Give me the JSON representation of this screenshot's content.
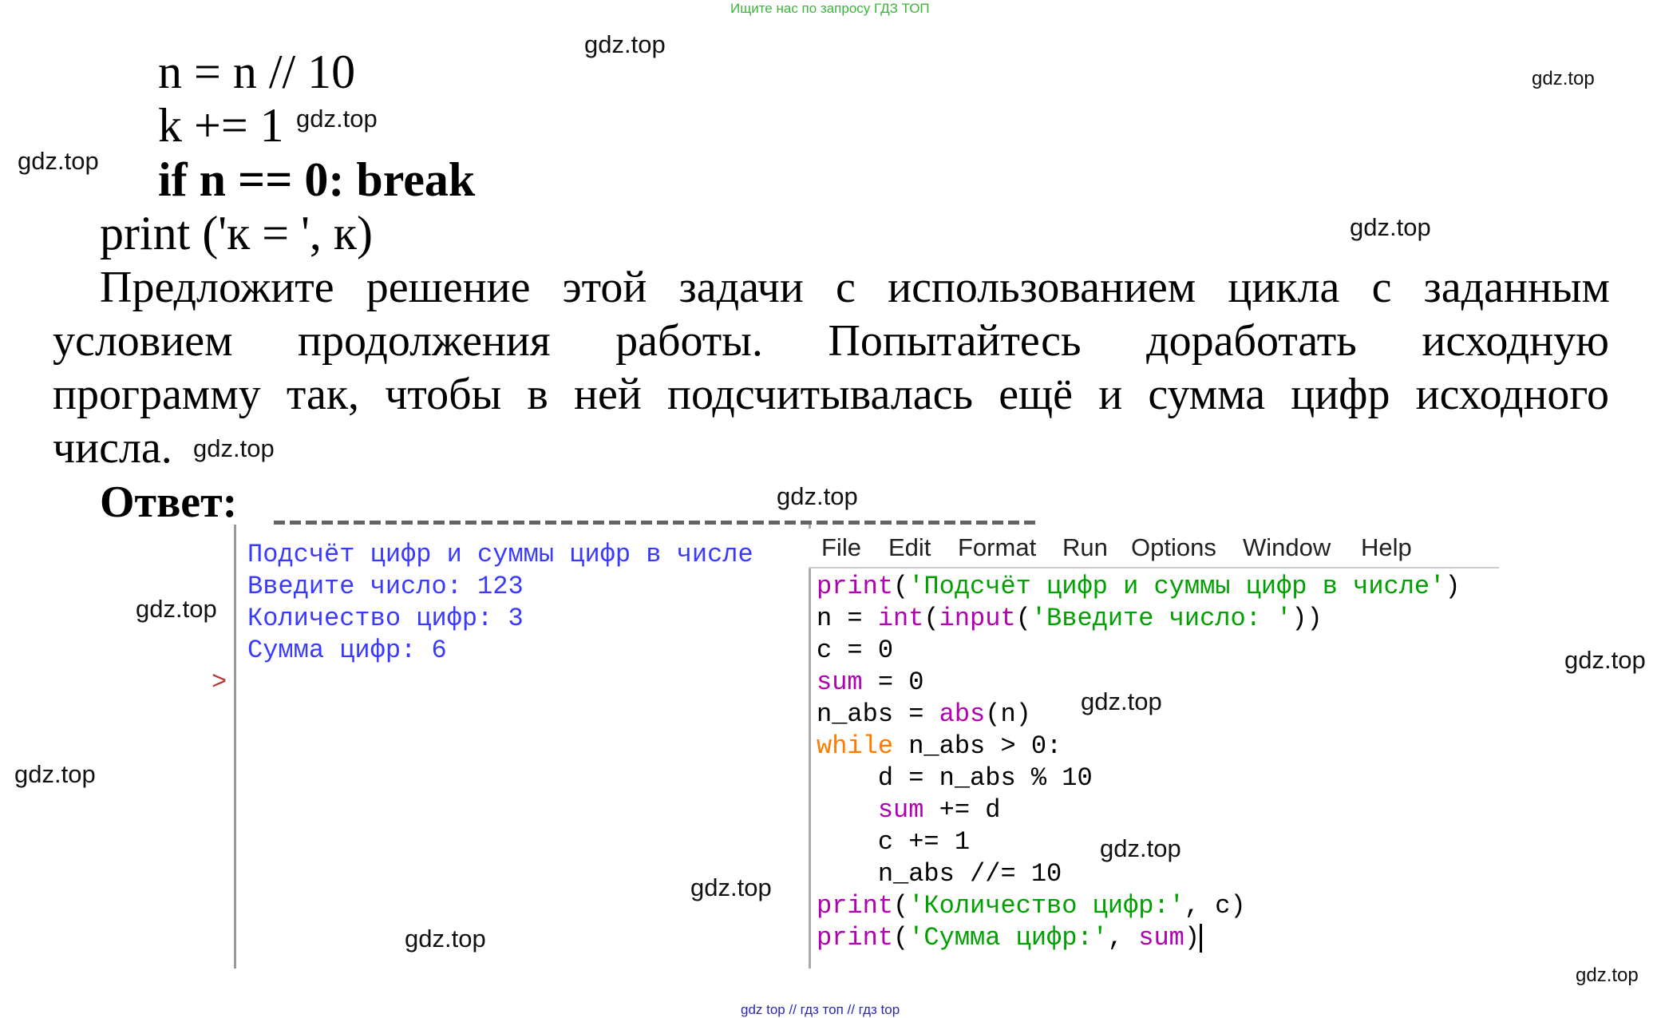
{
  "banner": "Ищите нас по запросу ГДЗ ТОП",
  "watermark": "gdz.top",
  "code_lines": {
    "line1": "n = n // 10",
    "line2": "k += 1",
    "line3": "if n == 0: break",
    "line4": "print ('к = ', к)"
  },
  "paragraph": {
    "line1": "Предложите решение этой задачи с использованием цикла с заданным",
    "line2": "условием продолжения работы. Попытайтесь доработать исходную",
    "line3": "программу так, чтобы в ней подсчитывалась ещё и сумма цифр исходного",
    "line4": "числа."
  },
  "answer_label": "Ответ:",
  "shell": {
    "lines": [
      "Подсчёт цифр и суммы цифр в числе",
      "Введите число: 123",
      "Количество цифр: 3",
      "Сумма цифр: 6"
    ],
    "prompt": ">"
  },
  "editor": {
    "menu": [
      "File",
      "Edit",
      "Format",
      "Run",
      "Options",
      "Window",
      "Help"
    ],
    "lines": [
      [
        {
          "t": "print",
          "c": "kw"
        },
        {
          "t": "(",
          "c": "nm"
        },
        {
          "t": "'Подсчёт цифр и суммы цифр в числе'",
          "c": "str"
        },
        {
          "t": ")",
          "c": "nm"
        }
      ],
      [
        {
          "t": "n = ",
          "c": "nm"
        },
        {
          "t": "int",
          "c": "kw"
        },
        {
          "t": "(",
          "c": "nm"
        },
        {
          "t": "input",
          "c": "kw"
        },
        {
          "t": "(",
          "c": "nm"
        },
        {
          "t": "'Введите число: '",
          "c": "str"
        },
        {
          "t": "))",
          "c": "nm"
        }
      ],
      [
        {
          "t": "c = 0",
          "c": "nm"
        }
      ],
      [
        {
          "t": "sum",
          "c": "kw"
        },
        {
          "t": " = 0",
          "c": "nm"
        }
      ],
      [
        {
          "t": "n_abs = ",
          "c": "nm"
        },
        {
          "t": "abs",
          "c": "kw"
        },
        {
          "t": "(n)",
          "c": "nm"
        }
      ],
      [
        {
          "t": "while",
          "c": "ctl"
        },
        {
          "t": " n_abs > 0:",
          "c": "nm"
        }
      ],
      [
        {
          "t": "    d = n_abs % 10",
          "c": "nm"
        }
      ],
      [
        {
          "t": "    ",
          "c": "nm"
        },
        {
          "t": "sum",
          "c": "kw"
        },
        {
          "t": " += d",
          "c": "nm"
        }
      ],
      [
        {
          "t": "    c += 1",
          "c": "nm"
        }
      ],
      [
        {
          "t": "    n_abs //= 10",
          "c": "nm"
        }
      ],
      [
        {
          "t": "print",
          "c": "kw"
        },
        {
          "t": "(",
          "c": "nm"
        },
        {
          "t": "'Количество цифр:'",
          "c": "str"
        },
        {
          "t": ", c)",
          "c": "nm"
        }
      ],
      [
        {
          "t": "print",
          "c": "kw"
        },
        {
          "t": "(",
          "c": "nm"
        },
        {
          "t": "'Сумма цифр:'",
          "c": "str"
        },
        {
          "t": ", ",
          "c": "nm"
        },
        {
          "t": "sum",
          "c": "kw"
        },
        {
          "t": ")",
          "c": "nm"
        }
      ]
    ]
  },
  "bottom_links": "gdz top  //  гдз топ  //  гдз top",
  "colors": {
    "keyword": "#b000b0",
    "control": "#ff7a00",
    "string": "#00a000",
    "shell_output": "#3a3aff",
    "prompt": "#b33a3a",
    "banner": "#3cb43c"
  }
}
